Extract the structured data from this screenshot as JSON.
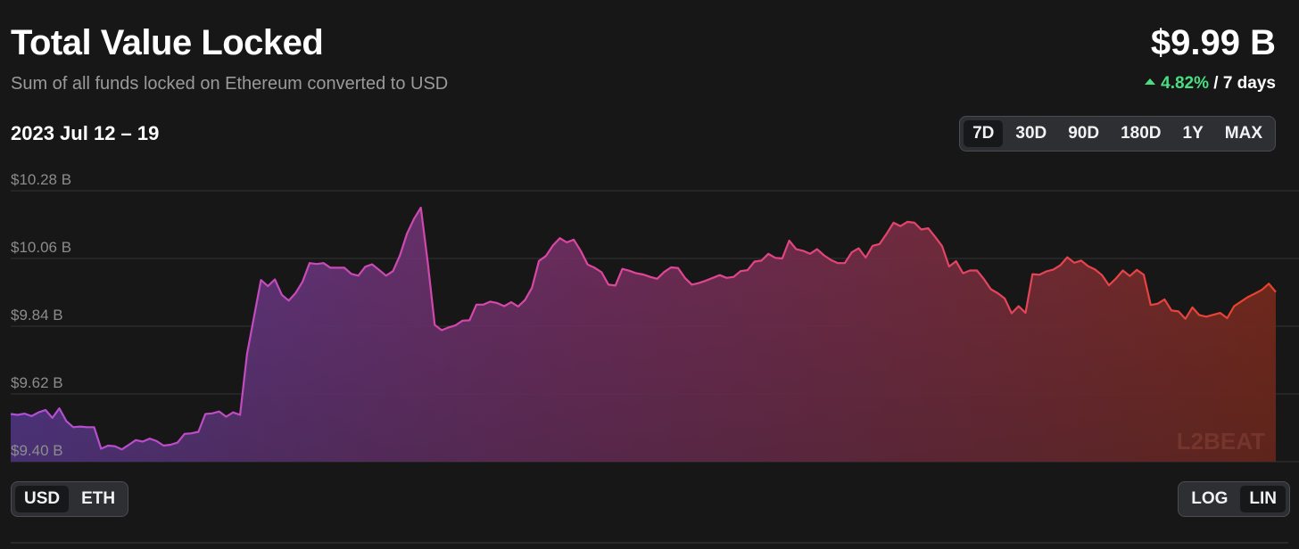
{
  "header": {
    "title": "Total Value Locked",
    "subtitle": "Sum of all funds locked on Ethereum converted to USD",
    "tvl_value": "$9.99 B",
    "tvl_change_pct": "4.82%",
    "tvl_change_period": "/ 7 days"
  },
  "date_range": "2023 Jul 12 – 19",
  "range_options": [
    {
      "label": "7D",
      "active": true
    },
    {
      "label": "30D",
      "active": false
    },
    {
      "label": "90D",
      "active": false
    },
    {
      "label": "180D",
      "active": false
    },
    {
      "label": "1Y",
      "active": false
    },
    {
      "label": "MAX",
      "active": false
    }
  ],
  "unit_options": [
    {
      "label": "USD",
      "active": true
    },
    {
      "label": "ETH",
      "active": false
    }
  ],
  "scale_options": [
    {
      "label": "LOG",
      "active": false
    },
    {
      "label": "LIN",
      "active": true
    }
  ],
  "watermark": "L2BEAT",
  "colors": {
    "background": "#171717",
    "gradient_start": "#b04fd6",
    "gradient_mid": "#e0459a",
    "gradient_end": "#e8432a",
    "positive": "#4ade80"
  },
  "chart_data": {
    "type": "area",
    "y_ticks": [
      "$10.28 B",
      "$10.06 B",
      "$9.84 B",
      "$9.62 B",
      "$9.40 B"
    ],
    "y_tick_values": [
      10.28,
      10.06,
      9.84,
      9.62,
      9.4
    ],
    "ylim": [
      9.4,
      10.28
    ],
    "scale": "linear",
    "grid": true,
    "x_start": "2023-07-12",
    "x_end": "2023-07-19",
    "values": [
      9.555,
      9.552,
      9.556,
      9.548,
      9.56,
      9.568,
      9.542,
      9.573,
      9.532,
      9.512,
      9.514,
      9.512,
      9.512,
      9.442,
      9.452,
      9.45,
      9.44,
      9.455,
      9.47,
      9.465,
      9.475,
      9.467,
      9.452,
      9.455,
      9.462,
      9.49,
      9.492,
      9.497,
      9.555,
      9.557,
      9.563,
      9.546,
      9.56,
      9.552,
      9.75,
      9.87,
      9.99,
      9.97,
      9.992,
      9.942,
      9.923,
      9.948,
      9.985,
      10.045,
      10.042,
      10.045,
      10.03,
      10.03,
      10.03,
      10.01,
      10.004,
      10.033,
      10.041,
      10.023,
      10.004,
      10.019,
      10.07,
      10.14,
      10.188,
      10.225,
      10.046,
      9.844,
      9.827,
      9.836,
      9.843,
      9.858,
      9.859,
      9.91,
      9.91,
      9.92,
      9.915,
      9.905,
      9.918,
      9.904,
      9.925,
      9.965,
      10.052,
      10.068,
      10.102,
      10.126,
      10.112,
      10.121,
      10.085,
      10.04,
      10.03,
      10.015,
      9.975,
      9.972,
      10.026,
      10.02,
      10.012,
      10.008,
      10.0,
      9.994,
      10.016,
      10.031,
      10.029,
      9.997,
      9.975,
      9.98,
      9.988,
      9.997,
      10.006,
      9.997,
      10.0,
      10.019,
      10.022,
      10.05,
      10.053,
      10.075,
      10.062,
      10.06,
      10.118,
      10.09,
      10.085,
      10.075,
      10.09,
      10.07,
      10.055,
      10.045,
      10.045,
      10.08,
      10.093,
      10.063,
      10.101,
      10.107,
      10.14,
      10.176,
      10.165,
      10.179,
      10.176,
      10.154,
      10.158,
      10.13,
      10.1,
      10.034,
      10.051,
      10.012,
      10.021,
      10.021,
      9.993,
      9.96,
      9.947,
      9.93,
      9.882,
      9.905,
      9.883,
      10.009,
      10.007,
      10.018,
      10.024,
      10.038,
      10.064,
      10.046,
      10.053,
      10.035,
      10.024,
      10.006,
      9.973,
      9.995,
      10.021,
      10.003,
      10.023,
      10.007,
      9.909,
      9.913,
      9.927,
      9.891,
      9.888,
      9.864,
      9.901,
      9.876,
      9.871,
      9.877,
      9.883,
      9.866,
      9.905,
      9.92,
      9.935,
      9.946,
      9.958,
      9.978,
      9.951
    ]
  }
}
